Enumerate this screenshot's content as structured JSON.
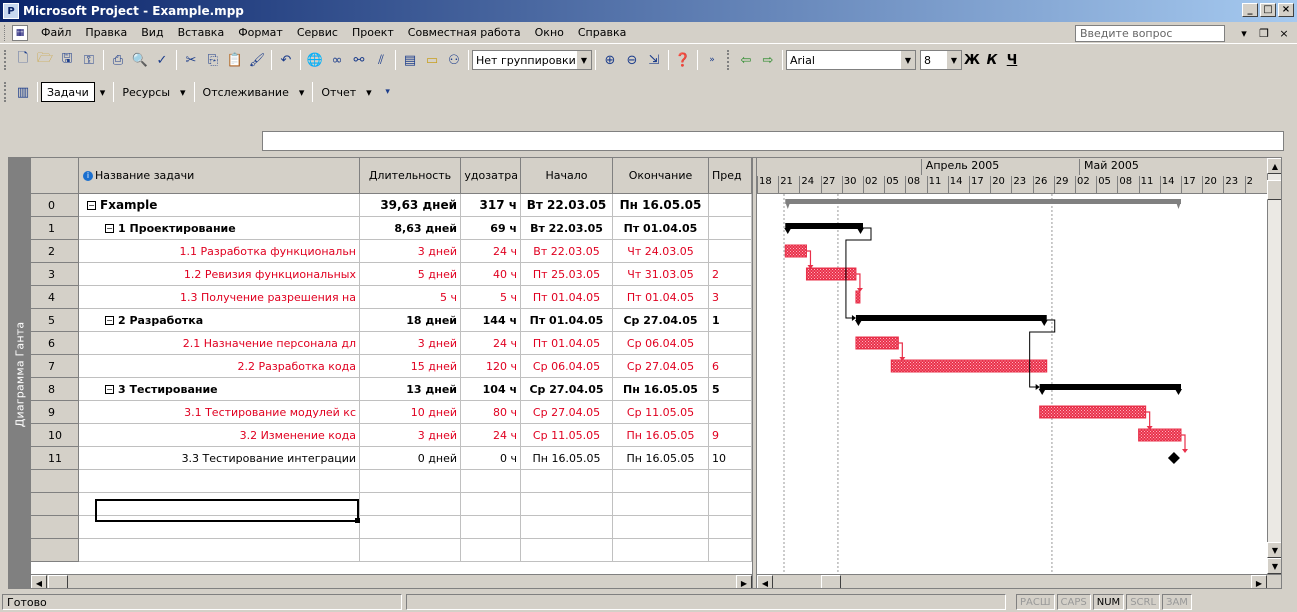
{
  "window": {
    "title": "Microsoft Project - Example.mpp"
  },
  "menu": {
    "items": [
      "Файл",
      "Правка",
      "Вид",
      "Вставка",
      "Формат",
      "Сервис",
      "Проект",
      "Совместная работа",
      "Окно",
      "Справка"
    ],
    "ask_placeholder": "Введите вопрос"
  },
  "toolbar": {
    "grouping": "Нет группировки",
    "font": "Arial",
    "font_size": "8",
    "bold": "Ж",
    "italic": "К",
    "underline": "Ч"
  },
  "guide_toolbar": {
    "items": [
      "Задачи",
      "Ресурсы",
      "Отслеживание",
      "Отчет"
    ]
  },
  "sidebar": {
    "label": "Диаграмма Ганта"
  },
  "table": {
    "headers": {
      "name": "Название задачи",
      "duration": "Длительность",
      "work": "удозатра",
      "start": "Начало",
      "finish": "Окончание",
      "pred": "Пред"
    },
    "rows": [
      {
        "id": "0",
        "name": "Fxample",
        "duration": "39,63 дней",
        "work": "317 ч",
        "start": "Вт 22.03.05",
        "finish": "Пн 16.05.05",
        "pred": "",
        "level": 0,
        "type": "project"
      },
      {
        "id": "1",
        "name": "1 Проектирование",
        "duration": "8,63 дней",
        "work": "69 ч",
        "start": "Вт 22.03.05",
        "finish": "Пт 01.04.05",
        "pred": "",
        "level": 1,
        "type": "summary"
      },
      {
        "id": "2",
        "name": "1.1 Разработка функциональн",
        "duration": "3 дней",
        "work": "24 ч",
        "start": "Вт 22.03.05",
        "finish": "Чт 24.03.05",
        "pred": "",
        "level": 2,
        "type": "critical"
      },
      {
        "id": "3",
        "name": "1.2 Ревизия функциональных",
        "duration": "5 дней",
        "work": "40 ч",
        "start": "Пт 25.03.05",
        "finish": "Чт 31.03.05",
        "pred": "2",
        "level": 2,
        "type": "critical"
      },
      {
        "id": "4",
        "name": "1.3 Получение разрешения на",
        "duration": "5 ч",
        "work": "5 ч",
        "start": "Пт 01.04.05",
        "finish": "Пт 01.04.05",
        "pred": "3",
        "level": 2,
        "type": "critical"
      },
      {
        "id": "5",
        "name": "2 Разработка",
        "duration": "18 дней",
        "work": "144 ч",
        "start": "Пт 01.04.05",
        "finish": "Ср 27.04.05",
        "pred": "1",
        "level": 1,
        "type": "summary"
      },
      {
        "id": "6",
        "name": "2.1 Назначение персонала дл",
        "duration": "3 дней",
        "work": "24 ч",
        "start": "Пт 01.04.05",
        "finish": "Ср 06.04.05",
        "pred": "",
        "level": 2,
        "type": "critical"
      },
      {
        "id": "7",
        "name": "2.2 Разработка кода",
        "duration": "15 дней",
        "work": "120 ч",
        "start": "Ср 06.04.05",
        "finish": "Ср 27.04.05",
        "pred": "6",
        "level": 2,
        "type": "critical"
      },
      {
        "id": "8",
        "name": "3 Тестирование",
        "duration": "13 дней",
        "work": "104 ч",
        "start": "Ср 27.04.05",
        "finish": "Пн 16.05.05",
        "pred": "5",
        "level": 1,
        "type": "summary"
      },
      {
        "id": "9",
        "name": "3.1 Тестирование модулей кс",
        "duration": "10 дней",
        "work": "80 ч",
        "start": "Ср 27.04.05",
        "finish": "Ср 11.05.05",
        "pred": "",
        "level": 2,
        "type": "critical"
      },
      {
        "id": "10",
        "name": "3.2 Изменение кода",
        "duration": "3 дней",
        "work": "24 ч",
        "start": "Ср 11.05.05",
        "finish": "Пн 16.05.05",
        "pred": "9",
        "level": 2,
        "type": "critical"
      },
      {
        "id": "11",
        "name": "3.3 Тестирование интеграции",
        "duration": "0 дней",
        "work": "0 ч",
        "start": "Пн 16.05.05",
        "finish": "Пн 16.05.05",
        "pred": "10",
        "level": 2,
        "type": "milestone"
      }
    ]
  },
  "gantt": {
    "months": [
      "Апрель 2005",
      "Май 2005"
    ],
    "days": [
      "18",
      "21",
      "24",
      "27",
      "30",
      "02",
      "05",
      "08",
      "11",
      "14",
      "17",
      "20",
      "23",
      "26",
      "29",
      "02",
      "05",
      "08",
      "11",
      "14",
      "17",
      "20",
      "23",
      "2"
    ],
    "bars": [
      {
        "row": 0,
        "type": "project",
        "start": "2005-03-22",
        "finish": "2005-05-16"
      },
      {
        "row": 1,
        "type": "summary",
        "start": "2005-03-22",
        "finish": "2005-04-01"
      },
      {
        "row": 2,
        "type": "task",
        "start": "2005-03-22",
        "finish": "2005-03-24"
      },
      {
        "row": 3,
        "type": "task",
        "start": "2005-03-25",
        "finish": "2005-03-31"
      },
      {
        "row": 4,
        "type": "task",
        "start": "2005-04-01",
        "finish": "2005-04-01"
      },
      {
        "row": 5,
        "type": "summary",
        "start": "2005-04-01",
        "finish": "2005-04-27"
      },
      {
        "row": 6,
        "type": "task",
        "start": "2005-04-01",
        "finish": "2005-04-06"
      },
      {
        "row": 7,
        "type": "task",
        "start": "2005-04-06",
        "finish": "2005-04-27"
      },
      {
        "row": 8,
        "type": "summary",
        "start": "2005-04-27",
        "finish": "2005-05-16"
      },
      {
        "row": 9,
        "type": "task",
        "start": "2005-04-27",
        "finish": "2005-05-11"
      },
      {
        "row": 10,
        "type": "task",
        "start": "2005-05-11",
        "finish": "2005-05-16"
      },
      {
        "row": 11,
        "type": "milestone",
        "start": "2005-05-16",
        "finish": "2005-05-16"
      }
    ],
    "colors": {
      "critical": "#e8304a",
      "summary": "#000000",
      "project": "#808080"
    }
  },
  "status": {
    "text": "Готово",
    "indicators": [
      {
        "label": "РАСШ",
        "on": false
      },
      {
        "label": "CAPS",
        "on": false
      },
      {
        "label": "NUM",
        "on": true
      },
      {
        "label": "SCRL",
        "on": false
      },
      {
        "label": "ЗАМ",
        "on": false
      }
    ]
  }
}
